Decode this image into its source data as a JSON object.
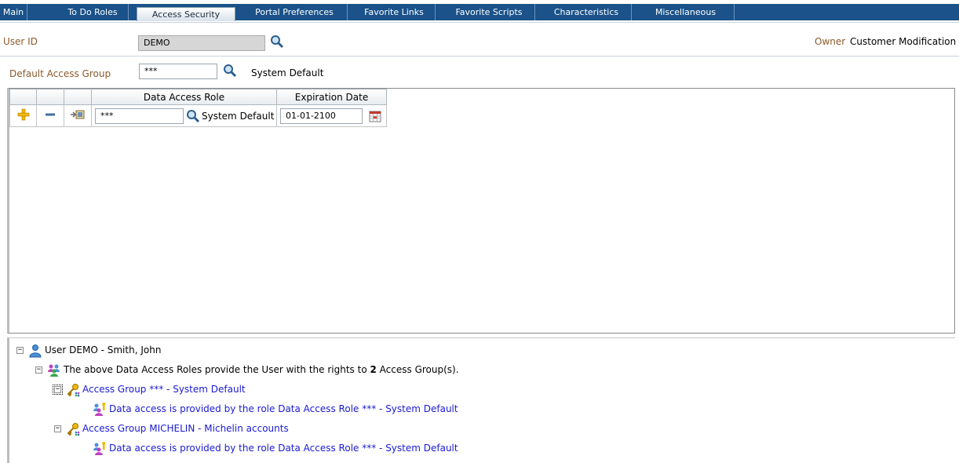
{
  "tabs": [
    {
      "label": "Main"
    },
    {
      "label": "To Do Roles"
    },
    {
      "label": "Access Security"
    },
    {
      "label": "Portal Preferences"
    },
    {
      "label": "Favorite Links"
    },
    {
      "label": "Favorite Scripts"
    },
    {
      "label": "Characteristics"
    },
    {
      "label": "Miscellaneous"
    }
  ],
  "user": {
    "label": "User ID",
    "value": "DEMO",
    "owner_label": "Owner",
    "owner_value": "Customer Modification"
  },
  "default_access_group": {
    "label": "Default Access Group",
    "value": "***",
    "description": "System Default"
  },
  "grid": {
    "headers": {
      "role": "Data Access Role",
      "expiration": "Expiration Date"
    },
    "rows": [
      {
        "role": "***",
        "role_description": "System Default",
        "expiration": "01-01-2100"
      }
    ]
  },
  "tree": {
    "user_node": "User DEMO - Smith, John",
    "summary_prefix": "The above Data Access Roles provide the User with the rights to ",
    "summary_count": "2",
    "summary_suffix": " Access Group(s).",
    "groups": [
      {
        "label": "Access Group *** - System Default",
        "detail": "Data access is provided by the role Data Access Role *** - System Default"
      },
      {
        "label": "Access Group MICHELIN - Michelin accounts",
        "detail": "Data access is provided by the role Data Access Role *** - System Default"
      }
    ]
  }
}
